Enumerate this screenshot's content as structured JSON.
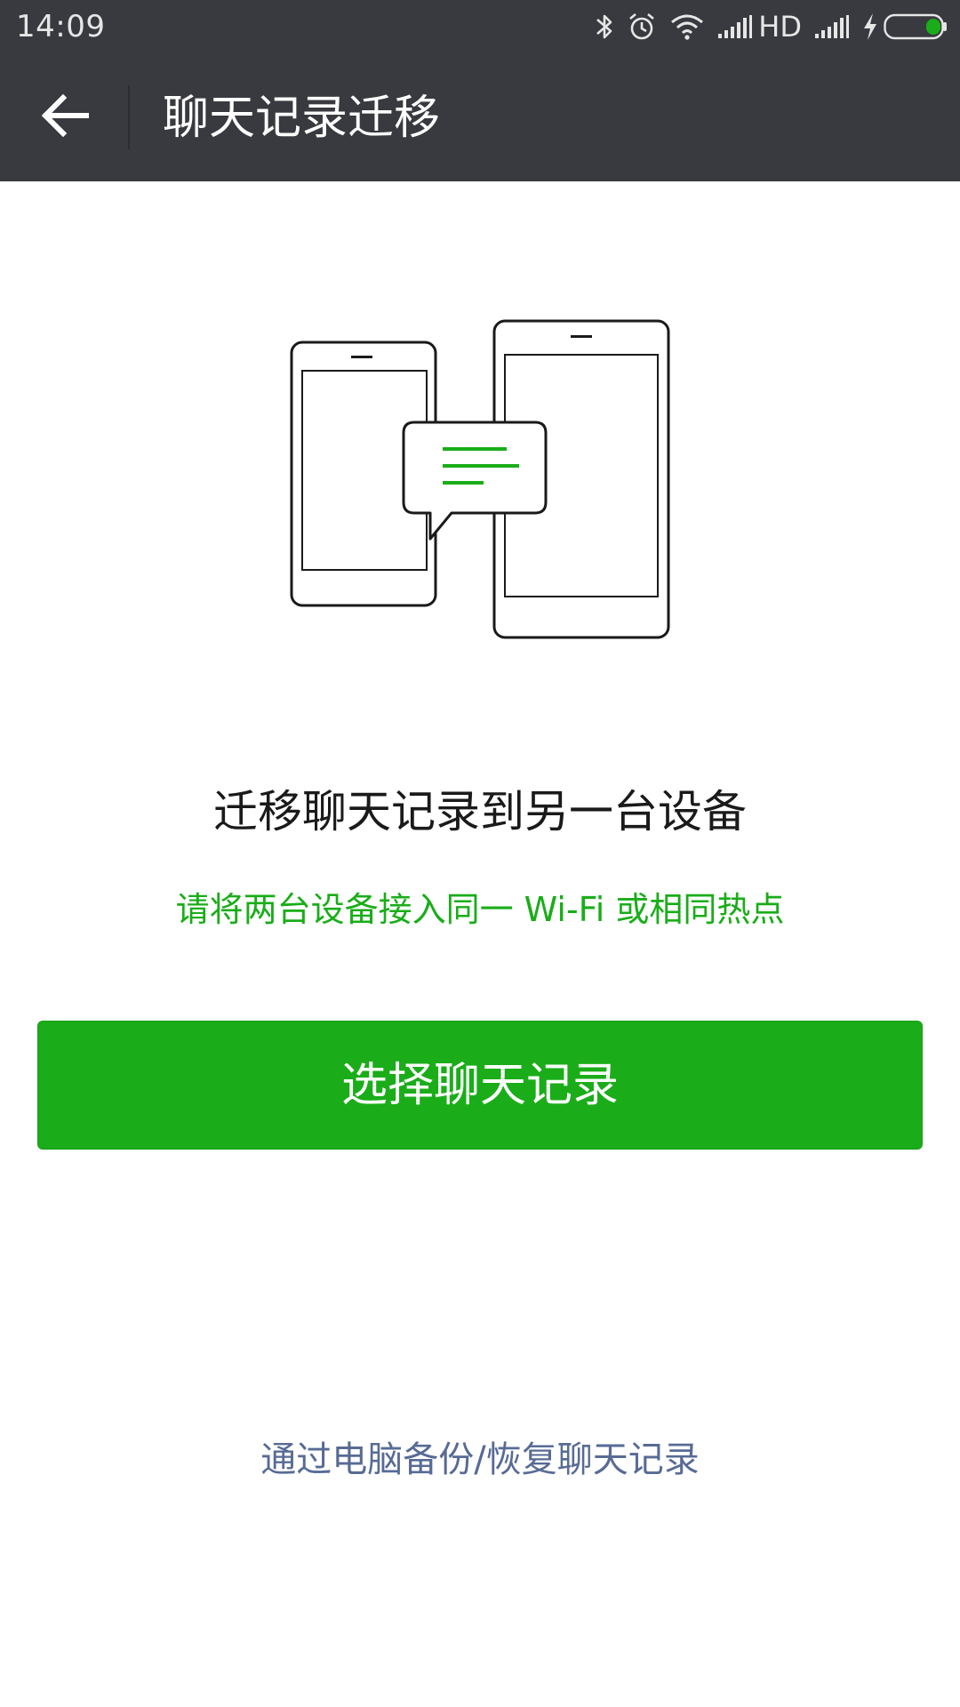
{
  "status_bar": {
    "time": "14:09",
    "network_label": "HD",
    "icons": [
      "bluetooth-icon",
      "alarm-icon",
      "wifi-icon",
      "signal-icon",
      "signal-icon",
      "charging-icon",
      "battery-icon"
    ],
    "battery_color": "#1aad19"
  },
  "app_bar": {
    "title": "聊天记录迁移",
    "back_icon": "arrow-left-icon",
    "background": "#393a3f"
  },
  "main": {
    "illustration": "two-phones-message-icon",
    "headline": "迁移聊天记录到另一台设备",
    "hint": "请将两台设备接入同一 Wi-Fi 或相同热点",
    "primary_button": "选择聊天记录",
    "pc_link": "通过电脑备份/恢复聊天记录"
  },
  "colors": {
    "accent_green": "#1aad19",
    "link_blue": "#576b95"
  }
}
